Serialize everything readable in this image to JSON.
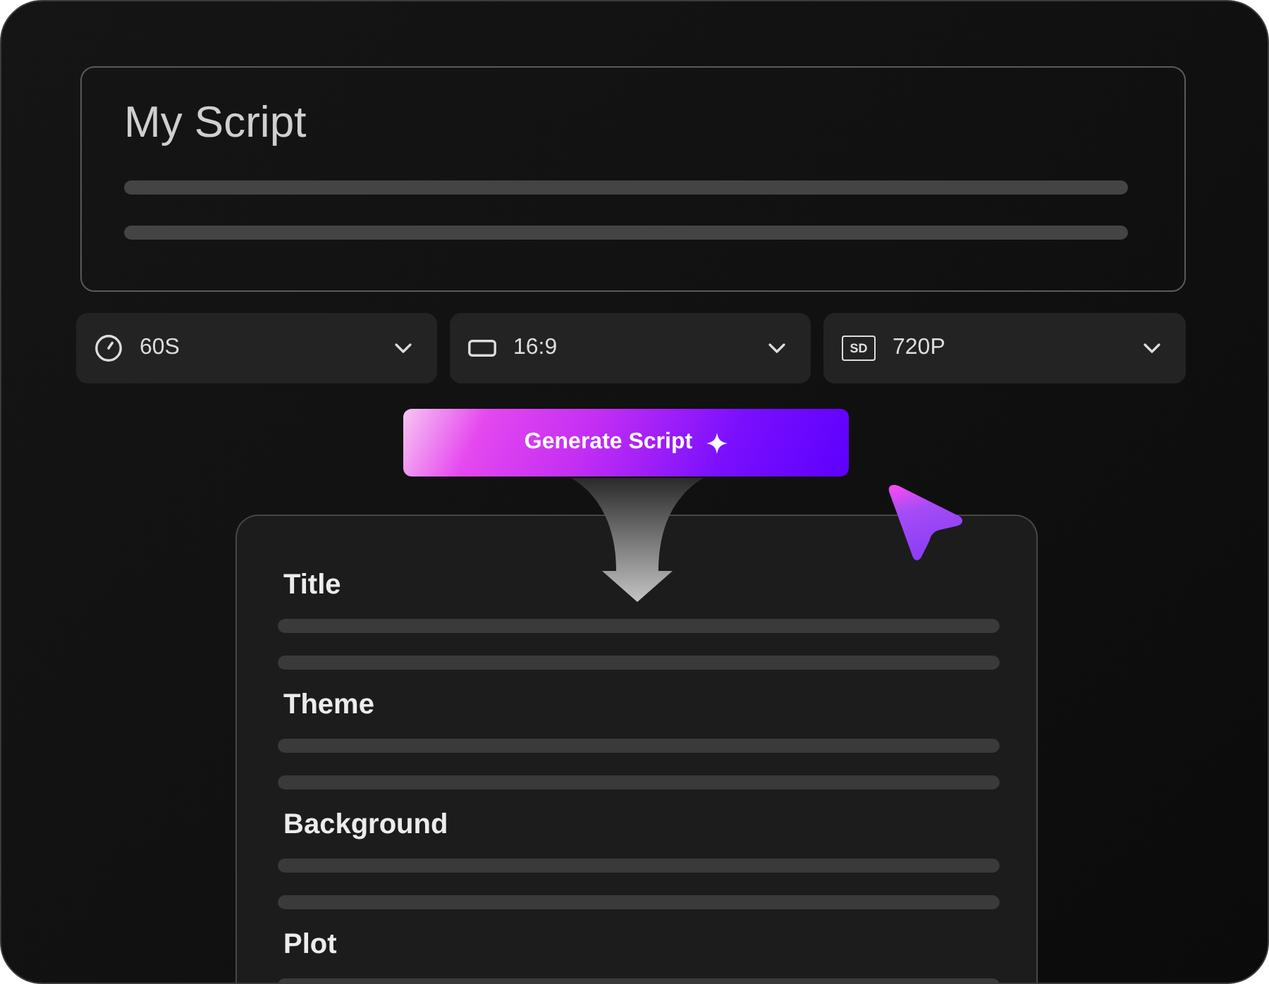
{
  "script_card": {
    "title": "My Script"
  },
  "options": [
    {
      "kind": "duration",
      "value": "60S"
    },
    {
      "kind": "aspect",
      "value": "16:9"
    },
    {
      "kind": "quality",
      "badge": "SD",
      "value": "720P"
    }
  ],
  "generate_button": {
    "label": "Generate Script"
  },
  "result_card": {
    "sections": [
      {
        "heading": "Title"
      },
      {
        "heading": "Theme"
      },
      {
        "heading": "Background"
      },
      {
        "heading": "Plot"
      }
    ]
  }
}
